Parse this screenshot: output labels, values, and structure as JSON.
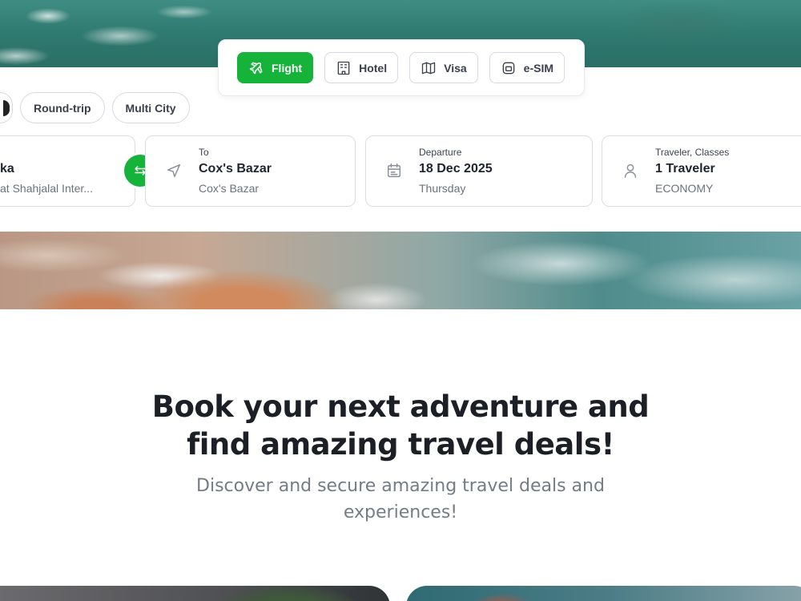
{
  "service_tabs": [
    {
      "label": "Flight",
      "icon": "airplane-icon",
      "active": true
    },
    {
      "label": "Hotel",
      "icon": "hotel-icon",
      "active": false
    },
    {
      "label": "Visa",
      "icon": "map-book-icon",
      "active": false
    },
    {
      "label": "e-SIM",
      "icon": "sim-card-icon",
      "active": false
    }
  ],
  "trip_types": [
    {
      "label": "Round-trip"
    },
    {
      "label": "Multi City"
    }
  ],
  "search": {
    "from": {
      "value": "Dhaka",
      "value_visible": "ka",
      "sub": "Hazrat Shahjalal Inter...",
      "sub_visible": "at Shahjalal Inter..."
    },
    "to": {
      "label": "To",
      "value": "Cox's Bazar",
      "sub": "Cox's Bazar"
    },
    "departure": {
      "label": "Departure",
      "value": "18 Dec 2025",
      "sub": "Thursday"
    },
    "travelers": {
      "label": "Traveler, Classes",
      "value": "1 Traveler",
      "sub": "ECONOMY"
    }
  },
  "hero": {
    "title_line1": "Book your next adventure and",
    "title_line2": "find amazing travel deals!",
    "subtitle_line1": "Discover and secure amazing travel deals and",
    "subtitle_line2": "experiences!"
  },
  "colors": {
    "accent": "#16b33b",
    "text_dark": "#1c1f26",
    "text_muted": "#757b87",
    "border": "#d9dce2"
  }
}
